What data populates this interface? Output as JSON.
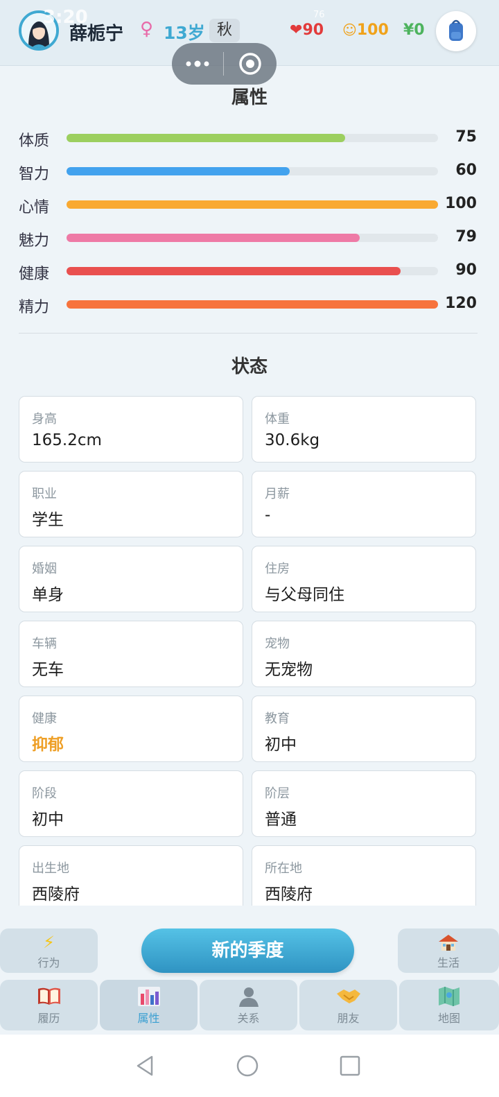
{
  "header": {
    "status_time": "3:20",
    "status_icons": "76",
    "name": "薛栀宁",
    "gender_symbol": "♀",
    "age": "13岁",
    "season": "秋",
    "heart_value": "90",
    "happy_value": "100",
    "money_value": "¥0"
  },
  "attributes": {
    "title": "属性",
    "items": [
      {
        "label": "体质",
        "value": "75",
        "fill": 0.75,
        "color": "#9ccf5f"
      },
      {
        "label": "智力",
        "value": "60",
        "fill": 0.6,
        "color": "#42a2ee"
      },
      {
        "label": "心情",
        "value": "100",
        "fill": 1.0,
        "color": "#f9a931"
      },
      {
        "label": "魅力",
        "value": "79",
        "fill": 0.79,
        "color": "#ee7aa6"
      },
      {
        "label": "健康",
        "value": "90",
        "fill": 0.9,
        "color": "#e9504f"
      },
      {
        "label": "精力",
        "value": "120",
        "fill": 1.0,
        "color": "#f7733d"
      }
    ]
  },
  "status": {
    "title": "状态",
    "cards": [
      {
        "key": "身高",
        "value": "165.2cm"
      },
      {
        "key": "体重",
        "value": "30.6kg"
      },
      {
        "key": "职业",
        "value": "学生"
      },
      {
        "key": "月薪",
        "value": "-"
      },
      {
        "key": "婚姻",
        "value": "单身"
      },
      {
        "key": "住房",
        "value": "与父母同住"
      },
      {
        "key": "车辆",
        "value": "无车"
      },
      {
        "key": "宠物",
        "value": "无宠物"
      },
      {
        "key": "健康",
        "value": "抑郁",
        "warn": true
      },
      {
        "key": "教育",
        "value": "初中"
      },
      {
        "key": "阶段",
        "value": "初中"
      },
      {
        "key": "阶层",
        "value": "普通"
      },
      {
        "key": "出生地",
        "value": "西陵府"
      },
      {
        "key": "所在地",
        "value": "西陵府"
      }
    ]
  },
  "actions": {
    "behavior_label": "行为",
    "new_season_label": "新的季度",
    "life_label": "生活"
  },
  "tabs": [
    {
      "label": "履历",
      "icon": "book-icon"
    },
    {
      "label": "属性",
      "icon": "bar-chart-icon",
      "active": true
    },
    {
      "label": "关系",
      "icon": "person-icon"
    },
    {
      "label": "朋友",
      "icon": "handshake-icon"
    },
    {
      "label": "地图",
      "icon": "map-icon"
    }
  ]
}
